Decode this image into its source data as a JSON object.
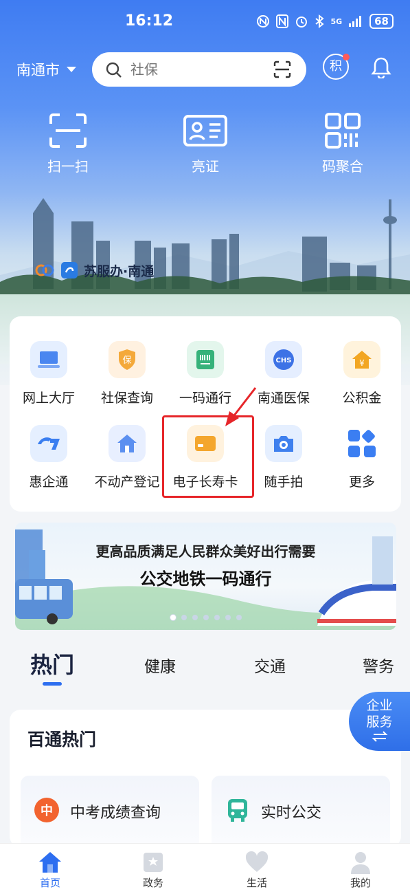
{
  "status": {
    "time": "16:12",
    "battery": "68",
    "network": "5G"
  },
  "header": {
    "city": "南通市",
    "search_placeholder": "社保",
    "points_label": "积"
  },
  "quick_actions": [
    {
      "label": "扫一扫",
      "icon": "scan-icon"
    },
    {
      "label": "亮证",
      "icon": "id-card-icon"
    },
    {
      "label": "码聚合",
      "icon": "qr-code-icon"
    }
  ],
  "brand": {
    "text": "苏服办·南通"
  },
  "services": [
    {
      "label": "网上大厅",
      "icon": "laptop-icon",
      "color": "#4a86f0"
    },
    {
      "label": "社保查询",
      "icon": "shield-icon",
      "color": "#f4a93a"
    },
    {
      "label": "一码通行",
      "icon": "barcode-icon",
      "color": "#36b27a"
    },
    {
      "label": "南通医保",
      "icon": "chs-icon",
      "color": "#3d72e6"
    },
    {
      "label": "公积金",
      "icon": "house-yen-icon",
      "color": "#f2a623"
    },
    {
      "label": "惠企通",
      "icon": "hand-g-icon",
      "color": "#3a7ef0"
    },
    {
      "label": "不动产登记",
      "icon": "house-icon",
      "color": "#5b8ff0"
    },
    {
      "label": "电子长寿卡",
      "icon": "card-icon",
      "color": "#f4a62d"
    },
    {
      "label": "随手拍",
      "icon": "camera-icon",
      "color": "#3f80ee"
    },
    {
      "label": "更多",
      "icon": "grid-icon",
      "color": "#3b7ef2"
    }
  ],
  "banner": {
    "line1": "更高品质满足人民群众美好出行需要",
    "line2": "公交地铁一码通行"
  },
  "tabs": [
    {
      "label": "热门",
      "active": true
    },
    {
      "label": "健康",
      "active": false
    },
    {
      "label": "交通",
      "active": false
    },
    {
      "label": "警务",
      "active": false
    }
  ],
  "hot": {
    "title": "百通热门",
    "items": [
      {
        "label": "中考成绩查询",
        "badge": "中",
        "color": "#f2632f"
      },
      {
        "label": "实时公交",
        "badge": "",
        "color": "#2fb59a"
      }
    ]
  },
  "enterprise": {
    "line1": "企业",
    "line2": "服务"
  },
  "bottom_nav": [
    {
      "label": "首页",
      "active": true
    },
    {
      "label": "政务",
      "active": false
    },
    {
      "label": "生活",
      "active": false
    },
    {
      "label": "我的",
      "active": false
    }
  ]
}
